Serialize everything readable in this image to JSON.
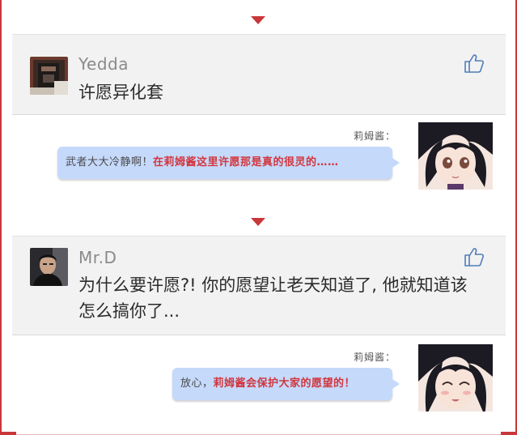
{
  "threads": [
    {
      "user": "Yedda",
      "comment": "许愿异化套",
      "replier": "莉姆酱：",
      "reply_normal": "武者大大冷静啊！",
      "reply_highlight": "在莉姆酱这里许愿那是真的很灵的……"
    },
    {
      "user": "Mr.D",
      "comment": "为什么要许愿?! 你的愿望让老天知道了, 他就知道该怎么搞你了...",
      "replier": "莉姆酱：",
      "reply_normal": "放心，",
      "reply_highlight": "莉姆酱会保护大家的愿望的！"
    }
  ],
  "icons": {
    "separator": "red-down-triangle",
    "like": "thumbs-up-outline",
    "reply_avatar": "anime-girl-avatar"
  },
  "colors": {
    "accent": "#c8373a",
    "bubble": "#c5d9fb",
    "highlight": "#d2363d",
    "card": "#f2f2f2"
  }
}
